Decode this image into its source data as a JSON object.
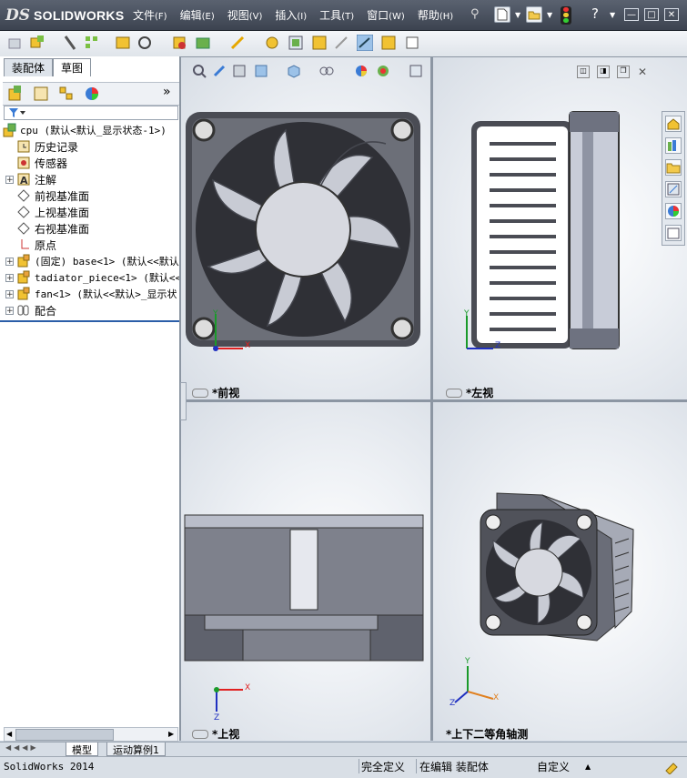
{
  "app": {
    "logo_prefix": "DS",
    "logo_name": "SOLIDWORKS"
  },
  "menu": [
    {
      "label": "文件",
      "key": "(F)"
    },
    {
      "label": "编辑",
      "key": "(E)"
    },
    {
      "label": "视图",
      "key": "(V)"
    },
    {
      "label": "插入",
      "key": "(I)"
    },
    {
      "label": "工具",
      "key": "(T)"
    },
    {
      "label": "窗口",
      "key": "(W)"
    },
    {
      "label": "帮助",
      "key": "(H)"
    }
  ],
  "window_controls": {
    "help": "?",
    "minimize": "—",
    "restore": "□",
    "close": "✕"
  },
  "left_panel": {
    "tabs": [
      "装配体",
      "草图"
    ],
    "expand_arrow": "»",
    "tree": [
      {
        "label": "cpu  (默认<默认_显示状态-1>)",
        "icon": "assembly-icon",
        "expander": false
      },
      {
        "label": "历史记录",
        "icon": "history-icon",
        "expander": false
      },
      {
        "label": "传感器",
        "icon": "sensor-icon",
        "expander": false
      },
      {
        "label": "注解",
        "icon": "annotation-icon",
        "expander": true
      },
      {
        "label": "前视基准面",
        "icon": "plane-icon",
        "expander": false
      },
      {
        "label": "上视基准面",
        "icon": "plane-icon",
        "expander": false
      },
      {
        "label": "右视基准面",
        "icon": "plane-icon",
        "expander": false
      },
      {
        "label": "原点",
        "icon": "origin-icon",
        "expander": false
      },
      {
        "label": "(固定) base<1> (默认<<默认",
        "icon": "part-icon",
        "expander": true
      },
      {
        "label": "tadiator_piece<1> (默认<<默",
        "icon": "part-icon",
        "expander": true
      },
      {
        "label": "fan<1> (默认<<默认>_显示状",
        "icon": "part-icon",
        "expander": true
      },
      {
        "label": "配合",
        "icon": "mate-icon",
        "expander": true
      }
    ]
  },
  "viewports": [
    {
      "label": "*前视",
      "axis_h": "X",
      "axis_v": "Y"
    },
    {
      "label": "*左视",
      "axis_h": "Z",
      "axis_v": "Y"
    },
    {
      "label": "*上视",
      "axis_h": "X",
      "axis_v": "Z"
    },
    {
      "label": "*上下二等角轴测",
      "axis_h": "X",
      "axis_v": "Y",
      "axis_z": "Z"
    }
  ],
  "bottom_tabs": [
    "模型",
    "运动算例1"
  ],
  "status": {
    "app_version": "SolidWorks 2014",
    "definition": "完全定义",
    "editing": "在编辑 装配体",
    "units": "自定义",
    "caret": "▲"
  },
  "colors": {
    "accent": "#2b5ea8",
    "axis_x": "#e02020",
    "axis_y": "#1a9a2a",
    "axis_z": "#2030c0",
    "panel": "#ffffff",
    "fan_body": "#55575f"
  }
}
